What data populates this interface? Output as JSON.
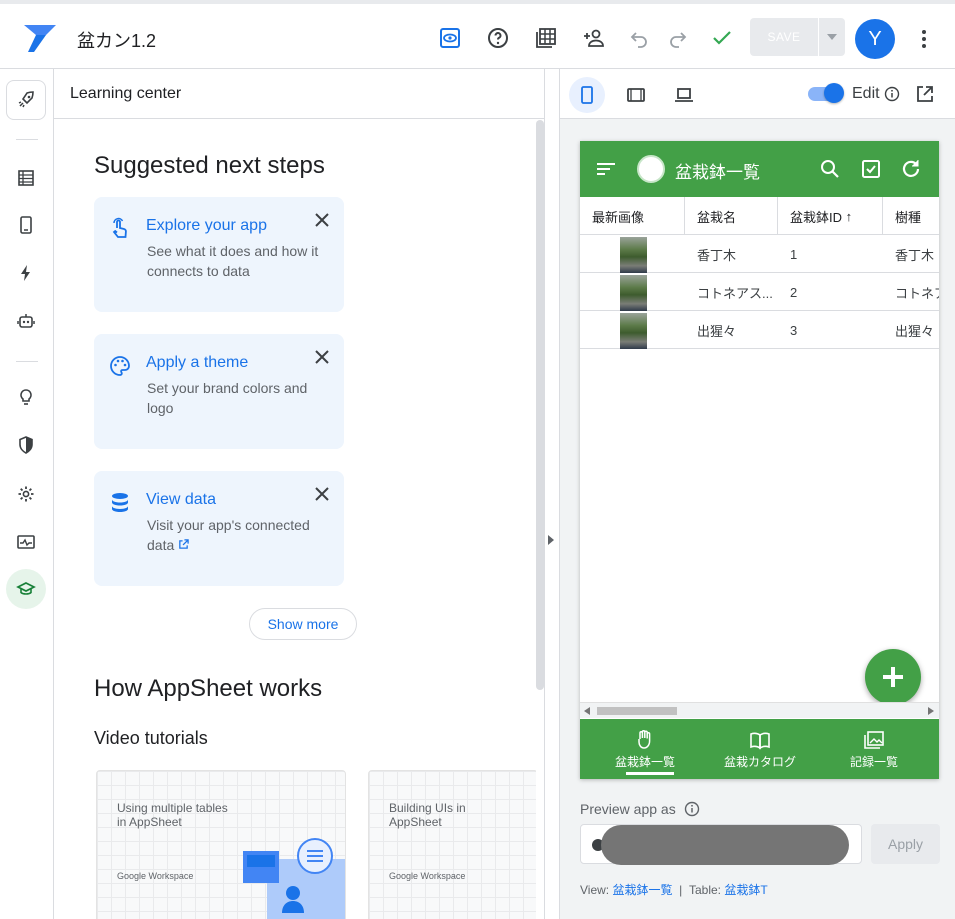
{
  "app": {
    "title": "盆カン1.2",
    "avatar_letter": "Y",
    "save_label": "SAVE"
  },
  "colors": {
    "accent": "#1a73e8",
    "app_green": "#43a047"
  },
  "toolbar_icons": [
    "preview-eye-icon",
    "help-icon",
    "table-grid-icon",
    "add-person-icon",
    "undo-icon",
    "redo-icon",
    "check-icon"
  ],
  "learning": {
    "header": "Learning center",
    "suggested_title": "Suggested next steps",
    "cards": [
      {
        "title": "Explore your app",
        "desc": "See what it does and how it connects to data",
        "icon": "touch-icon"
      },
      {
        "title": "Apply a theme",
        "desc": "Set your brand colors and logo",
        "icon": "palette-icon"
      },
      {
        "title": "View data",
        "desc": "Visit your app's connected data",
        "icon": "database-icon"
      }
    ],
    "show_more": "Show more",
    "how_title": "How AppSheet works",
    "video_title": "Video tutorials",
    "videos": [
      {
        "title": "Using multiple tables in AppSheet",
        "brand": "Google Workspace"
      },
      {
        "title": "Building UIs in AppSheet",
        "brand": "Google Workspace"
      }
    ]
  },
  "preview": {
    "edit_label": "Edit",
    "app_header": "盆栽鉢一覧",
    "columns": [
      "最新画像",
      "盆栽名",
      "盆栽鉢ID",
      "樹種"
    ],
    "sort_indicator": "↑",
    "rows": [
      {
        "name": "香丁木",
        "id": "1",
        "species": "香丁木"
      },
      {
        "name": "コトネアス...",
        "id": "2",
        "species": "コトネア"
      },
      {
        "name": "出猩々",
        "id": "3",
        "species": "出猩々"
      }
    ],
    "nav": [
      {
        "label": "盆栽鉢一覧",
        "icon": "hand-icon"
      },
      {
        "label": "盆栽カタログ",
        "icon": "book-icon"
      },
      {
        "label": "記録一覧",
        "icon": "images-icon"
      }
    ],
    "preview_as_label": "Preview app as",
    "apply_label": "Apply",
    "footer": {
      "view_label": "View:",
      "view_value": "盆栽鉢一覧",
      "sep": "|",
      "table_label": "Table:",
      "table_value": "盆栽鉢T"
    }
  }
}
